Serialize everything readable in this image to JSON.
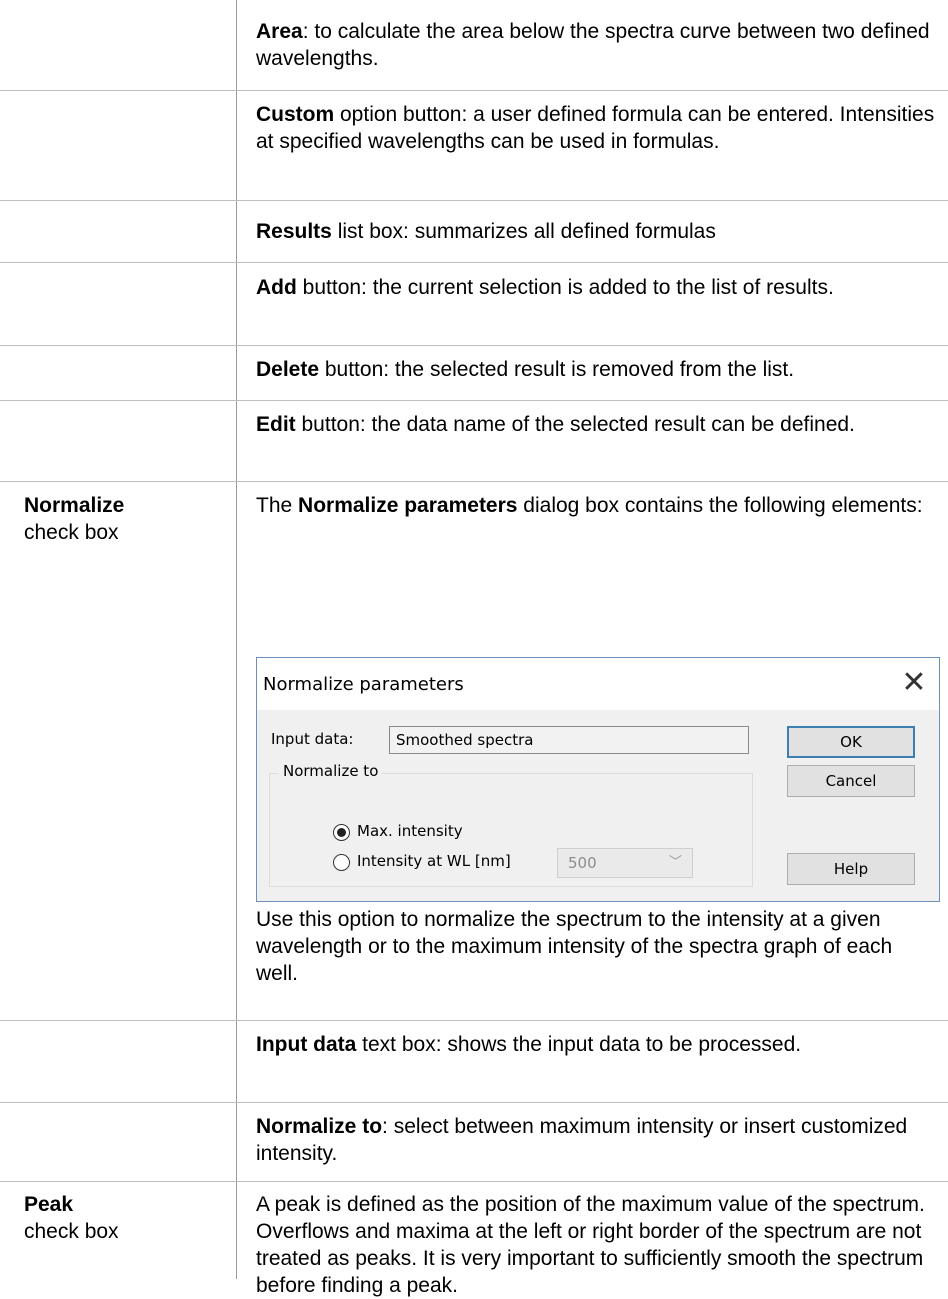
{
  "rows": [
    {
      "right": {
        "bold": "Area",
        "rest": ": to calculate the area below the spectra curve between two defined wavelengths."
      }
    },
    {
      "right": {
        "bold": "Custom",
        "rest": " option button: a user defined formula can be entered. Intensities at specified wavelengths can be used in formulas."
      }
    },
    {
      "right": {
        "bold": "Results",
        "rest": " list box: summarizes all defined formulas"
      }
    },
    {
      "right": {
        "bold": "Add",
        "rest": " button: the current selection is added to the list of results."
      }
    },
    {
      "right": {
        "bold": "Delete",
        "rest": " button: the selected result is removed from the list."
      }
    },
    {
      "right": {
        "bold": "Edit",
        "rest": " button: the data name of the selected result can be defined."
      }
    },
    {
      "left": {
        "bold": "Normalize",
        "rest": "check box"
      },
      "right_intro": {
        "pre": "The ",
        "bold": "Normalize parameters",
        "rest": " dialog box contains the following elements:"
      },
      "right_after": "Use this option to normalize the spectrum to the intensity at a given wavelength or to the maximum intensity of the spectra graph of each well."
    },
    {
      "right": {
        "bold": "Input data",
        "rest": " text box: shows the input data to be processed."
      }
    },
    {
      "right": {
        "bold": "Normalize to",
        "rest": ": select between maximum intensity or insert customized intensity."
      }
    },
    {
      "left": {
        "bold": "Peak",
        "rest": "check box"
      },
      "right_text": "A peak is defined as the position of the maximum value of the spectrum. Overflows and maxima at the left or right border of the spectrum are not treated as peaks. It is very important to sufficiently smooth the spectrum before finding a peak."
    }
  ],
  "dialog": {
    "title": "Normalize parameters",
    "close_icon": "close-icon",
    "input_label": "Input data:",
    "input_value": "Smoothed spectra",
    "ok_label": "OK",
    "cancel_label": "Cancel",
    "help_label": "Help",
    "group_label": "Normalize to",
    "radio_max_label": "Max. intensity",
    "radio_wl_label": "Intensity at WL [nm]",
    "radio_selected": "Max. intensity",
    "wl_value": "500",
    "border_color": "#6e8fb7",
    "default_button_color": "#3c7fb1"
  }
}
